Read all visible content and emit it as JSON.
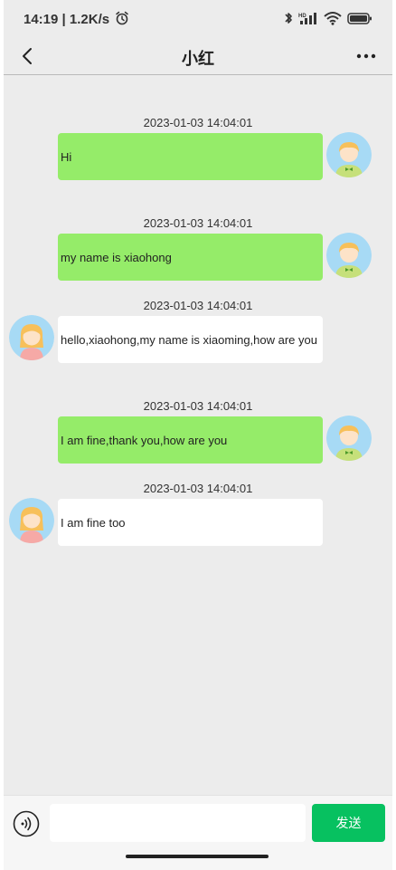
{
  "status": {
    "time": "14:19",
    "speed": "1.2K/s",
    "icons": [
      "alarm-icon",
      "bluetooth-icon",
      "signal-icon",
      "wifi-icon",
      "battery-icon"
    ]
  },
  "nav": {
    "title": "小红",
    "back_icon": "chevron-left-icon",
    "more_icon": "more-icon"
  },
  "messages": [
    {
      "timestamp": "2023-01-03 14:04:01",
      "text": "Hi",
      "side": "right"
    },
    {
      "timestamp": "2023-01-03 14:04:01",
      "text": "my name is xiaohong",
      "side": "right"
    },
    {
      "timestamp": "2023-01-03 14:04:01",
      "text": "hello,xiaohong,my name is xiaoming,how are you",
      "side": "left"
    },
    {
      "timestamp": "2023-01-03 14:04:01",
      "text": "I am fine,thank you,how are you",
      "side": "right"
    },
    {
      "timestamp": "2023-01-03 14:04:01",
      "text": "I am fine too",
      "side": "left"
    }
  ],
  "input": {
    "value": "",
    "placeholder": "",
    "send_label": "发送"
  },
  "colors": {
    "sent_bubble": "#95ec69",
    "received_bubble": "#ffffff",
    "send_button": "#07c160",
    "background": "#ececec"
  }
}
